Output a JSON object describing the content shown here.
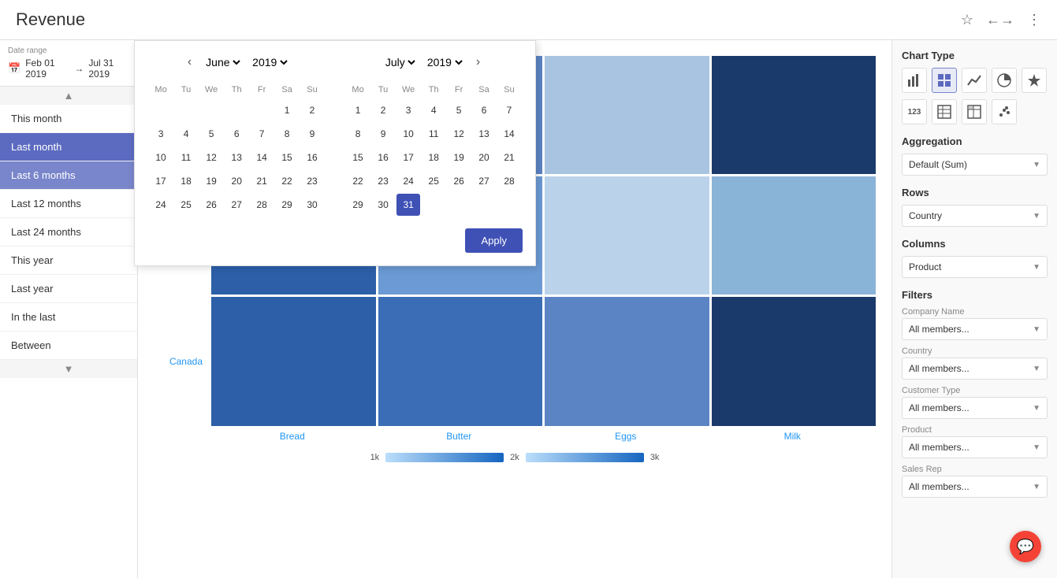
{
  "header": {
    "title": "Revenue",
    "icons": [
      "star-icon",
      "share-icon",
      "more-icon"
    ]
  },
  "dateRange": {
    "label": "Date range",
    "start": "Feb 01 2019",
    "arrow": "→",
    "end": "Jul 31 2019"
  },
  "dateMenu": {
    "items": [
      {
        "id": "this-month",
        "label": "This month",
        "active": false
      },
      {
        "id": "last-month",
        "label": "Last month",
        "active": true,
        "selected": true
      },
      {
        "id": "last-6-months",
        "label": "Last 6 months",
        "active": false
      },
      {
        "id": "last-12-months",
        "label": "Last 12 months",
        "active": false
      },
      {
        "id": "last-24-months",
        "label": "Last 24 months",
        "active": false
      },
      {
        "id": "this-year",
        "label": "This year",
        "active": false
      },
      {
        "id": "last-year",
        "label": "Last year",
        "active": false
      },
      {
        "id": "in-the-last",
        "label": "In the last",
        "active": false
      },
      {
        "id": "between",
        "label": "Between",
        "active": false
      }
    ]
  },
  "calendar": {
    "leftMonth": {
      "name": "June",
      "year": "2019",
      "weekdays": [
        "Mo",
        "Tu",
        "We",
        "Th",
        "Fr",
        "Sa",
        "Su"
      ],
      "weeks": [
        [
          "",
          "",
          "",
          "",
          "",
          "1",
          "2"
        ],
        [
          "3",
          "4",
          "5",
          "6",
          "7",
          "8",
          "9"
        ],
        [
          "10",
          "11",
          "12",
          "13",
          "14",
          "15",
          "16"
        ],
        [
          "17",
          "18",
          "19",
          "20",
          "21",
          "22",
          "23"
        ],
        [
          "24",
          "25",
          "26",
          "27",
          "28",
          "29",
          "30"
        ]
      ]
    },
    "rightMonth": {
      "name": "July",
      "year": "2019",
      "weekdays": [
        "Mo",
        "Tu",
        "We",
        "Th",
        "Fr",
        "Sa",
        "Su"
      ],
      "weeks": [
        [
          "1",
          "2",
          "3",
          "4",
          "5",
          "6",
          "7"
        ],
        [
          "8",
          "9",
          "10",
          "11",
          "12",
          "13",
          "14"
        ],
        [
          "15",
          "16",
          "17",
          "18",
          "19",
          "20",
          "21"
        ],
        [
          "22",
          "23",
          "24",
          "25",
          "26",
          "27",
          "28"
        ],
        [
          "29",
          "30",
          "31",
          "",
          "",
          "",
          ""
        ]
      ],
      "selected": "31"
    },
    "applyLabel": "Apply"
  },
  "heatmap": {
    "rowLabels": [
      "",
      "Canada"
    ],
    "colLabels": [
      "Bread",
      "Butter",
      "Eggs",
      "Milk"
    ],
    "legend": {
      "min": "1k",
      "mid": "2k",
      "max": "3k"
    },
    "cells": [
      [
        "light-blue",
        "medium-blue",
        "light-blue",
        "dark-navy"
      ],
      [
        "dark-blue",
        "medium-blue",
        "light-blue",
        "medium-light-blue"
      ],
      [
        "dark-blue",
        "medium-dark-blue",
        "medium-blue",
        "dark-blue"
      ]
    ]
  },
  "rightPanel": {
    "chartTypeLabel": "Chart Type",
    "chartTypeIcons": [
      {
        "name": "bar-chart-icon",
        "symbol": "▦"
      },
      {
        "name": "grid-chart-icon",
        "symbol": "⊞",
        "active": true
      },
      {
        "name": "line-chart-icon",
        "symbol": "╱"
      },
      {
        "name": "pie-chart-icon",
        "symbol": "◔"
      },
      {
        "name": "star-chart-icon",
        "symbol": "✦"
      }
    ],
    "chartTypeIcons2": [
      {
        "name": "number-chart-icon",
        "symbol": "123"
      },
      {
        "name": "table-chart-icon",
        "symbol": "⊟"
      },
      {
        "name": "pivot-chart-icon",
        "symbol": "⊠"
      },
      {
        "name": "scatter-chart-icon",
        "symbol": "⊡"
      }
    ],
    "aggregationLabel": "Aggregation",
    "aggregationValue": "Default (Sum)",
    "rowsLabel": "Rows",
    "rowsValue": "Country",
    "columnsLabel": "Columns",
    "columnsValue": "Product",
    "filtersLabel": "Filters",
    "filters": [
      {
        "label": "Company Name",
        "value": "All members..."
      },
      {
        "label": "Country",
        "value": "All members..."
      },
      {
        "label": "Customer Type",
        "value": "All members..."
      },
      {
        "label": "Product",
        "value": "All members..."
      },
      {
        "label": "Sales Rep",
        "value": "All members..."
      }
    ]
  }
}
